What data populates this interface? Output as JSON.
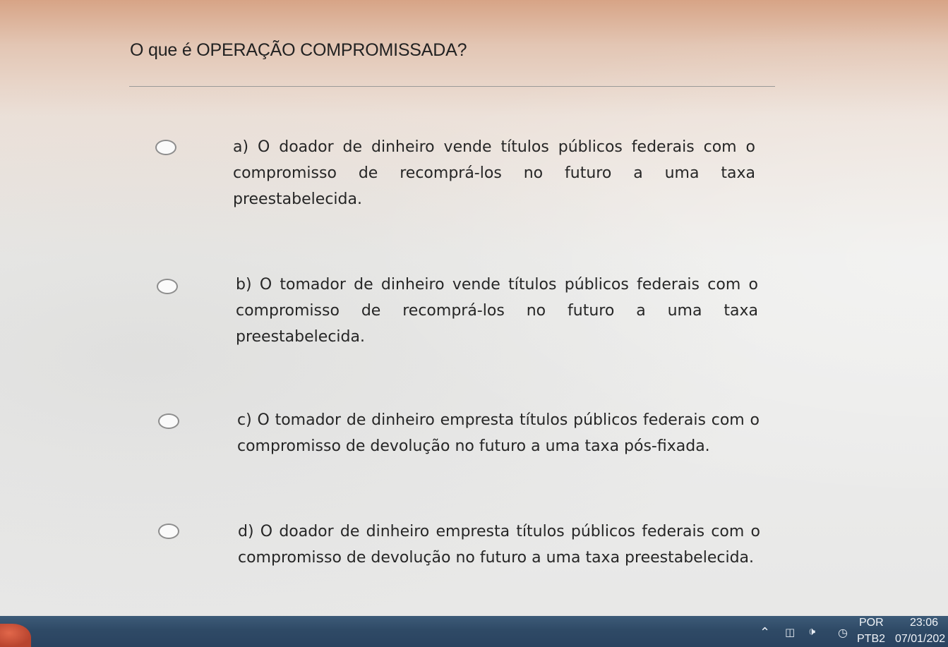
{
  "question": {
    "title": "O que é OPERAÇÃO COMPROMISSADA?"
  },
  "options": [
    {
      "text": "a) O doador de dinheiro vende títulos públicos federais com o compromisso de recomprá-los no futuro a uma taxa preestabelecida.",
      "selected": false
    },
    {
      "text": "b) O tomador de dinheiro vende títulos públicos federais com o compromisso de recomprá-los no futuro a uma taxa preestabelecida.",
      "selected": false
    },
    {
      "text": "c) O tomador de dinheiro empresta títulos públicos federais com o compromisso de devolução no futuro a uma taxa pós-fixada.",
      "selected": false
    },
    {
      "text": "d) O doador de dinheiro empresta títulos públicos federais com o compromisso de devolução no futuro a uma taxa preestabelecida.",
      "selected": false
    }
  ],
  "taskbar": {
    "language": "POR",
    "keyboard_layout": "PTB2",
    "time": "23:06",
    "date": "07/01/202",
    "icons": [
      "chevron-up-icon",
      "tablet-mode-icon",
      "volume-icon",
      "wifi-icon"
    ]
  },
  "colors": {
    "taskbar": "#2f4a66",
    "text": "#262626",
    "radio_border": "#8d8d8d"
  }
}
